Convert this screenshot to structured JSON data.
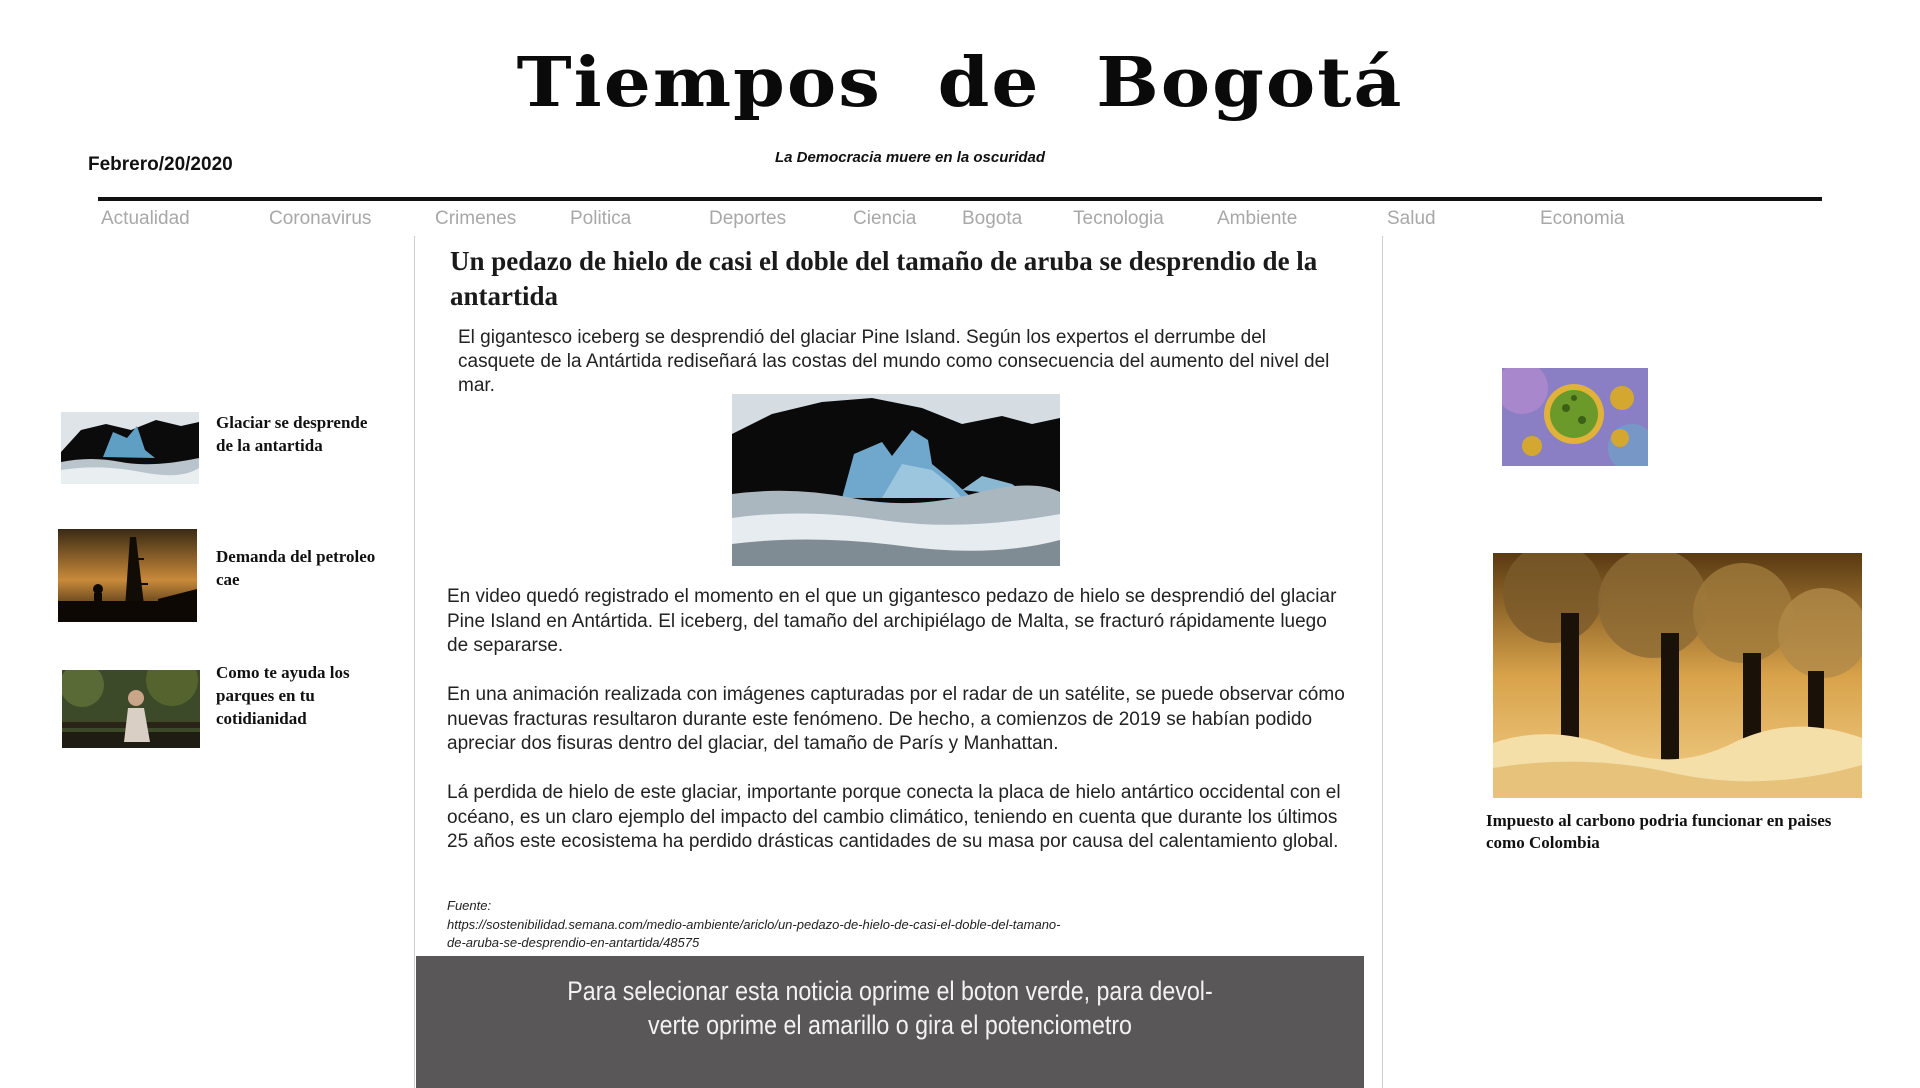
{
  "masthead": {
    "title": "Tiempos de Bogotá",
    "date": "Febrero/20/2020",
    "tagline": "La Democracia muere en la oscuridad"
  },
  "nav": [
    "Actualidad",
    "Coronavirus",
    "Crimenes",
    "Politica",
    "Deportes",
    "Ciencia",
    "Bogota",
    "Tecnologia",
    "Ambiente",
    "Salud",
    "Economia"
  ],
  "sidebar_left": [
    {
      "title": "Glaciar se desprende de la antartida",
      "image": "glacier"
    },
    {
      "title": "Demanda del petroleo cae",
      "image": "oil-rig-sunset"
    },
    {
      "title": "Como te ayuda los parques en tu cotidianidad",
      "image": "woman-in-park"
    }
  ],
  "article": {
    "headline": "Un pedazo de hielo de casi el doble del tamaño de aruba se desprendio de la antartida",
    "lead": "El gigantesco iceberg se desprendió del glaciar Pine Island. Según los expertos el derrumbe del casquete de la Antártida rediseñará las costas del mundo como consecuencia del aumento del nivel del mar.",
    "image": "iceberg",
    "paragraphs": [
      "En video quedó registrado el momento en el que un gigantesco pedazo de hielo se desprendió del glaciar Pine Island en Antártida. El iceberg, del tamaño del archipiélago de Malta, se fracturó rápidamente luego de separarse.",
      "En una animación realizada con imágenes capturadas por el radar de un satélite, se puede observar cómo nuevas fracturas resultaron durante este fenómeno. De hecho, a comienzos de 2019 se habían podido apreciar dos fisuras dentro del glaciar, del tamaño de París y Manhattan.",
      "Lá perdida de hielo de este glaciar, importante porque conecta la placa de hielo antártico occidental con el océano, es un claro ejemplo del impacto del cambio climático, teniendo en cuenta que durante los últimos 25 años este ecosistema ha perdido drásticas cantidades de su masa por causa del calentamiento global."
    ],
    "source_label": "Fuente:",
    "source_url": "https://sostenibilidad.semana.com/medio-ambiente/ariclo/un-pedazo-de-hielo-de-casi-el-doble-del-tamano-de-aruba-se-desprendio-en-antartida/48575"
  },
  "banner": {
    "line1": "Para selecionar esta noticia oprime el boton verde, para devol-",
    "line2": "verte oprime el amarillo o gira el potenciometro",
    "color": "#595757"
  },
  "sidebar_right": {
    "virus_image": "coronavirus",
    "feature_image": "smokestacks",
    "feature_title": "Impuesto al carbono podria funcionar en paises como Colombia"
  }
}
